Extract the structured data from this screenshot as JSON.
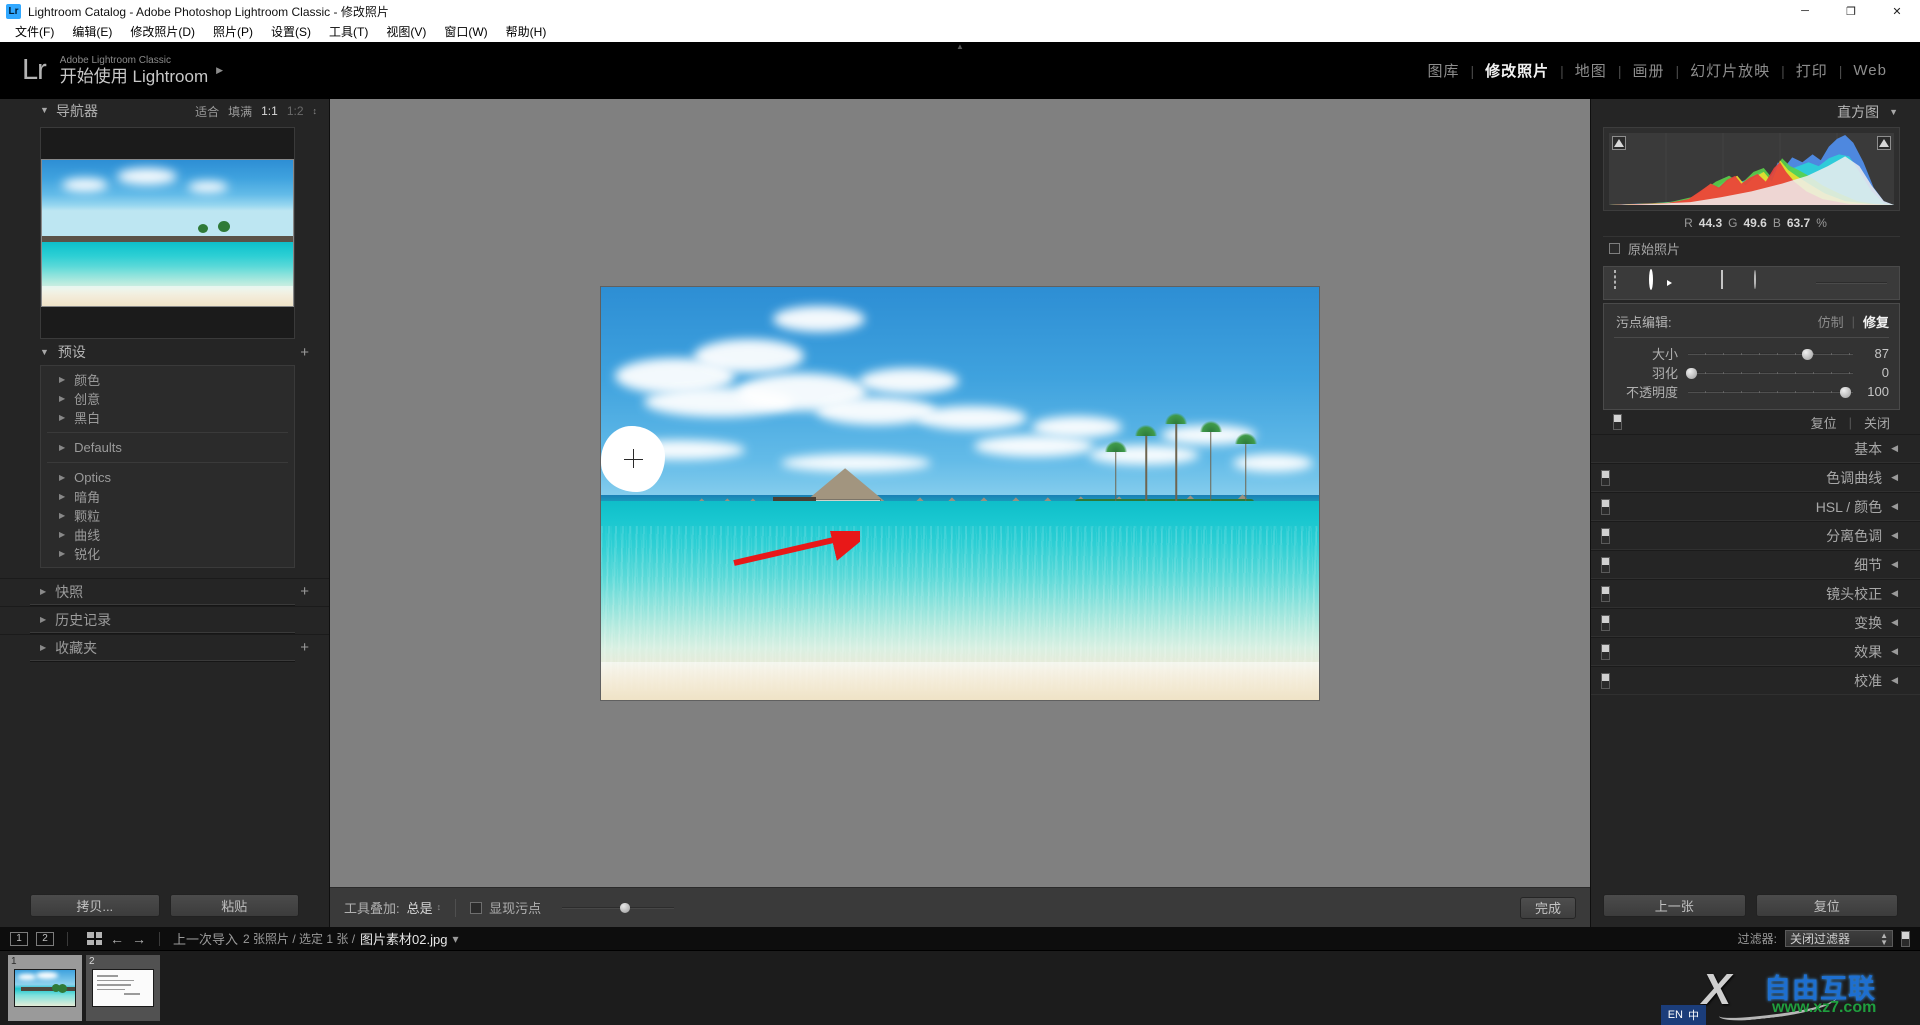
{
  "window": {
    "title": "Lightroom Catalog - Adobe Photoshop Lightroom Classic - 修改照片",
    "app_badge": "Lr",
    "minimize": "─",
    "maximize": "❐",
    "close": "✕"
  },
  "menubar": {
    "items": [
      {
        "label": "文件(F)"
      },
      {
        "label": "编辑(E)"
      },
      {
        "label": "修改照片(D)"
      },
      {
        "label": "照片(P)"
      },
      {
        "label": "设置(S)"
      },
      {
        "label": "工具(T)"
      },
      {
        "label": "视图(V)"
      },
      {
        "label": "窗口(W)"
      },
      {
        "label": "帮助(H)"
      }
    ]
  },
  "identity": {
    "logo": "Lr",
    "line1": "Adobe Lightroom Classic",
    "line2": "开始使用 Lightroom",
    "arrow": "▶"
  },
  "modules": {
    "items": [
      {
        "label": "图库",
        "active": false
      },
      {
        "label": "修改照片",
        "active": true
      },
      {
        "label": "地图",
        "active": false
      },
      {
        "label": "画册",
        "active": false
      },
      {
        "label": "幻灯片放映",
        "active": false
      },
      {
        "label": "打印",
        "active": false
      },
      {
        "label": "Web",
        "active": false
      }
    ],
    "separator": "|"
  },
  "left_panel": {
    "navigator": {
      "title": "导航器",
      "triangle": "▼",
      "modes": [
        "适合",
        "填满",
        "1:1",
        "1:2"
      ],
      "selected_mode": "1:1",
      "stepper": "↕"
    },
    "presets": {
      "title": "预设",
      "triangle": "▼",
      "plus": "+",
      "groups": [
        {
          "items": [
            "颜色",
            "创意",
            "黑白"
          ]
        },
        {
          "items": [
            "Defaults"
          ]
        },
        {
          "items": [
            "Optics",
            "暗角",
            "颗粒",
            "曲线",
            "锐化"
          ]
        }
      ],
      "item_triangle": "▶"
    },
    "collapsed_sections": [
      {
        "title": "快照",
        "triangle": "▶",
        "plus": "+"
      },
      {
        "title": "历史记录",
        "triangle": "▶",
        "plus": ""
      },
      {
        "title": "收藏夹",
        "triangle": "▶",
        "plus": "+"
      }
    ],
    "footer": {
      "copy_label": "拷贝...",
      "paste_label": "粘贴"
    }
  },
  "toolbar": {
    "overlay_label": "工具叠加:",
    "overlay_value": "总是",
    "stepper": "↕",
    "show_spots_label": "显现污点",
    "done_label": "完成"
  },
  "right_panel": {
    "histogram": {
      "title": "直方图",
      "triangle": "▼",
      "r_label": "R",
      "r_value": "44.3",
      "g_label": "G",
      "g_value": "49.6",
      "b_label": "B",
      "b_value": "63.7",
      "unit": "%"
    },
    "original_photo_label": "原始照片",
    "tool_icons": [
      {
        "name": "crop-icon"
      },
      {
        "name": "spot-removal-icon"
      },
      {
        "name": "red-eye-icon"
      },
      {
        "name": "graduated-filter-icon"
      },
      {
        "name": "radial-filter-icon"
      },
      {
        "name": "adjustment-brush-icon"
      }
    ],
    "spot_panel": {
      "title": "污点编辑:",
      "mode_clone": "仿制",
      "mode_heal": "修复",
      "separator": "|",
      "active_mode": "修复",
      "sliders": [
        {
          "label": "大小",
          "value": "87",
          "percent": 72
        },
        {
          "label": "羽化",
          "value": "0",
          "percent": 2
        },
        {
          "label": "不透明度",
          "value": "100",
          "percent": 95
        }
      ],
      "reset_label": "复位",
      "close_label": "关闭",
      "footer_sep": "|"
    },
    "sections": [
      {
        "title": "基本",
        "triangle": "◀",
        "has_switch": false
      },
      {
        "title": "色调曲线",
        "triangle": "◀",
        "has_switch": true
      },
      {
        "title": "HSL / 颜色",
        "triangle": "◀",
        "has_switch": true
      },
      {
        "title": "分离色调",
        "triangle": "◀",
        "has_switch": true
      },
      {
        "title": "细节",
        "triangle": "◀",
        "has_switch": true
      },
      {
        "title": "镜头校正",
        "triangle": "◀",
        "has_switch": true
      },
      {
        "title": "变换",
        "triangle": "◀",
        "has_switch": true
      },
      {
        "title": "效果",
        "triangle": "◀",
        "has_switch": true
      },
      {
        "title": "校准",
        "triangle": "◀",
        "has_switch": true
      }
    ],
    "footer": {
      "previous_label": "上一张",
      "reset_label": "复位"
    }
  },
  "filmstrip": {
    "view1": "1",
    "view2": "2",
    "back_arrow": "←",
    "forward_arrow": "→",
    "source_label": "上一次导入",
    "count_label": "2 张照片 / 选定 1 张 /",
    "filename": "图片素材02.jpg",
    "dropdown": "▾",
    "filter_label": "过滤器:",
    "filter_value": "关闭过滤器",
    "thumbs": [
      {
        "num": "1",
        "type": "photo",
        "selected": true
      },
      {
        "num": "2",
        "type": "document",
        "selected": false
      }
    ]
  },
  "watermark": {
    "x": "X",
    "chinese": "自由互联",
    "url": "www.xz7.com"
  },
  "ime": {
    "lang": "EN",
    "mode": "中"
  },
  "colors": {
    "accent": "#31a8ff",
    "panel_bg": "#252525",
    "canvas_bg": "#808080",
    "annotation_arrow": "#e81818"
  }
}
